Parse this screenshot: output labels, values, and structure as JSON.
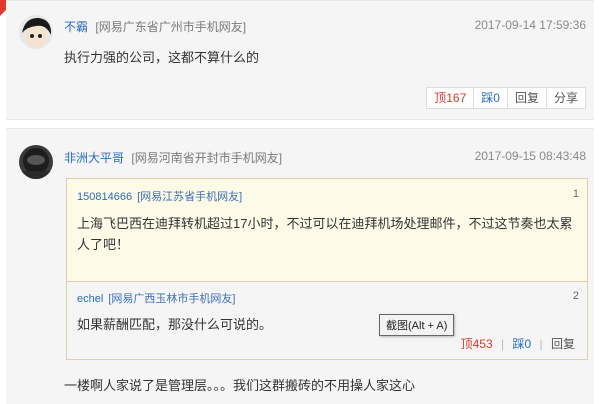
{
  "comment1": {
    "username": "不霸",
    "location": "[网易广东省广州市手机网友]",
    "time": "2017-09-14 17:59:36",
    "content": "执行力强的公司，这都不算什么的",
    "actions": {
      "up_label": "顶",
      "up_count": "167",
      "down_label": "踩",
      "down_count": "0",
      "reply": "回复",
      "share": "分享"
    }
  },
  "comment2": {
    "username": "非洲大平哥",
    "location": "[网易河南省开封市手机网友]",
    "time": "2017-09-15 08:43:48",
    "quote1": {
      "username": "150814666",
      "location": "[网易江苏省手机网友]",
      "floor": "1",
      "text": "上海飞巴西在迪拜转机超过17小时，不过可以在迪拜机场处理邮件，不过这节奏也太累人了吧！"
    },
    "quote2": {
      "username": "echel",
      "location": "[网易广西玉林市手机网友]",
      "floor": "2",
      "text": "如果薪酬匹配，那没什么可说的。",
      "actions": {
        "up_label": "顶",
        "up_count": "453",
        "down_label": "踩",
        "down_count": "0",
        "reply": "回复"
      }
    },
    "content": "一楼啊人家说了是管理层。。。我们这群搬砖的不用操人家这心"
  },
  "tooltip": "截图(Alt + A)",
  "colors": {
    "accent_red": "#e0392c",
    "link_blue": "#2a6ebb",
    "quote_bg": "#fdfbe8"
  }
}
